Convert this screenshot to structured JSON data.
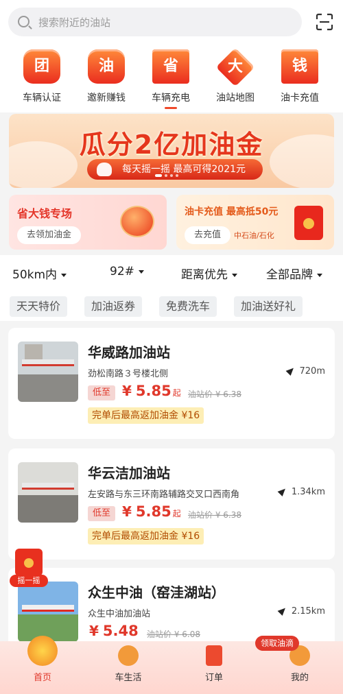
{
  "search": {
    "placeholder": "搜索附近的油站"
  },
  "quick": [
    {
      "glyph": "团",
      "label": "车辆认证"
    },
    {
      "glyph": "油",
      "label": "邀新赚钱"
    },
    {
      "glyph": "省",
      "label": "车辆充电"
    },
    {
      "glyph": "大",
      "label": "油站地图"
    },
    {
      "glyph": "钱",
      "label": "油卡充值"
    }
  ],
  "banner": {
    "title": "瓜分2亿加油金",
    "subtitle": "每天摇一摇  最高可得2021元"
  },
  "promos": {
    "left": {
      "title": "省大钱专场",
      "button": "去领加油金"
    },
    "right": {
      "title": "油卡充值 最高抵50元",
      "button": "去充值",
      "note": "中石油/石化"
    }
  },
  "filters": {
    "selects": [
      "50km内",
      "92#",
      "距离优先",
      "全部品牌"
    ],
    "tags": [
      "天天特价",
      "加油返券",
      "免费洗车",
      "加油送好礼"
    ]
  },
  "stations": [
    {
      "name": "华威路加油站",
      "address": "劲松南路３号楼北侧",
      "distance": "720m",
      "low_label": "低至",
      "yen": "¥",
      "price": "5.85",
      "qi": "起",
      "orig": "油站价 ¥ 6.38",
      "cashback": "完单后最高返加油金 ¥16"
    },
    {
      "name": "华云洁加油站",
      "address": "左安路与东三环南路辅路交叉口西南角",
      "distance": "1.34km",
      "low_label": "低至",
      "yen": "¥",
      "price": "5.85",
      "qi": "起",
      "orig": "油站价 ¥ 6.38",
      "cashback": "完单后最高返加油金 ¥16"
    },
    {
      "name": "众生中油（窑洼湖站）",
      "address": "众生中油加油站",
      "distance": "2.15km",
      "yen": "¥",
      "price": "5.48",
      "orig": "油站价 ¥ 6.08"
    }
  ],
  "shake": {
    "label": "摇一摇"
  },
  "nav": {
    "items": [
      "首页",
      "车生活",
      "订单",
      "我的"
    ],
    "badge": "领取油滴"
  },
  "colors": {
    "accent": "#e0382b",
    "brand_orange": "#f04a2a",
    "cashback_bg": "#fdeeb5"
  }
}
